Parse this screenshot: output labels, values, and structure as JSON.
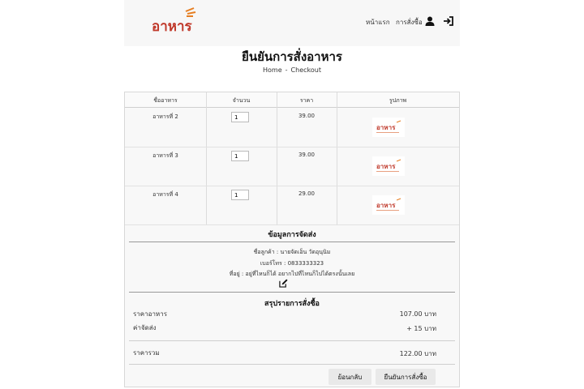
{
  "navbar": {
    "logo_text": "อาหาร",
    "home": "หน้าแรก",
    "orders": "การสั่งซื้อ"
  },
  "page": {
    "title": "ยืนยันการสั่งอาหาร",
    "breadcrumb": {
      "home": "Home",
      "sep": "-",
      "current": "Checkout"
    }
  },
  "table": {
    "headers": [
      "ชื่ออาหาร",
      "จำนวน",
      "ราคา",
      "รูปภาพ"
    ],
    "rows": [
      {
        "name": "อาหารที่ 2",
        "qty": "1",
        "price": "39.00"
      },
      {
        "name": "อาหารที่ 3",
        "qty": "1",
        "price": "39.00"
      },
      {
        "name": "อาหารที่ 4",
        "qty": "1",
        "price": "29.00"
      }
    ]
  },
  "shipping": {
    "title": "ข้อมูลการจัดส่ง",
    "customer": "ชื่อลูกค้า : นายจัดเอ็น วัดอุนุนิม",
    "phone": "เบอร์โทร : 0833333323",
    "address": "ที่อยู่ : อยู่ที่ไหนก็ได้ อยากไปที่ไหนก็ไปได้ตรงนั้นเลย"
  },
  "summary": {
    "title": "สรุปรายการสั่งซื้อ",
    "food_label": "ราคาอาหาร",
    "food_value": "107.00 บาท",
    "shipping_label": "ค่าจัดส่ง",
    "shipping_value": "+ 15 บาท",
    "total_label": "ราคารวม",
    "total_value": "122.00 บาท"
  },
  "buttons": {
    "back": "ย้อนกลับ",
    "confirm": "ยืนยันการสั่งซื้อ"
  },
  "colors": {
    "logo_red": "#c0392b",
    "logo_orange": "#e67e22",
    "nav_bg": "#f7f7f7"
  }
}
